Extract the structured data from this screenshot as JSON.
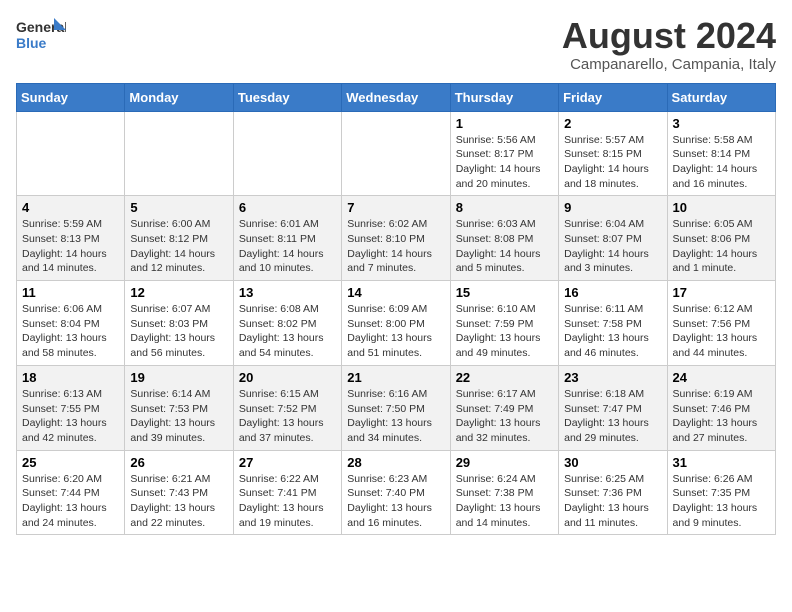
{
  "logo": {
    "line1": "General",
    "line2": "Blue"
  },
  "title": "August 2024",
  "subtitle": "Campanarello, Campania, Italy",
  "headers": [
    "Sunday",
    "Monday",
    "Tuesday",
    "Wednesday",
    "Thursday",
    "Friday",
    "Saturday"
  ],
  "weeks": [
    [
      {
        "num": "",
        "info": ""
      },
      {
        "num": "",
        "info": ""
      },
      {
        "num": "",
        "info": ""
      },
      {
        "num": "",
        "info": ""
      },
      {
        "num": "1",
        "info": "Sunrise: 5:56 AM\nSunset: 8:17 PM\nDaylight: 14 hours\nand 20 minutes."
      },
      {
        "num": "2",
        "info": "Sunrise: 5:57 AM\nSunset: 8:15 PM\nDaylight: 14 hours\nand 18 minutes."
      },
      {
        "num": "3",
        "info": "Sunrise: 5:58 AM\nSunset: 8:14 PM\nDaylight: 14 hours\nand 16 minutes."
      }
    ],
    [
      {
        "num": "4",
        "info": "Sunrise: 5:59 AM\nSunset: 8:13 PM\nDaylight: 14 hours\nand 14 minutes."
      },
      {
        "num": "5",
        "info": "Sunrise: 6:00 AM\nSunset: 8:12 PM\nDaylight: 14 hours\nand 12 minutes."
      },
      {
        "num": "6",
        "info": "Sunrise: 6:01 AM\nSunset: 8:11 PM\nDaylight: 14 hours\nand 10 minutes."
      },
      {
        "num": "7",
        "info": "Sunrise: 6:02 AM\nSunset: 8:10 PM\nDaylight: 14 hours\nand 7 minutes."
      },
      {
        "num": "8",
        "info": "Sunrise: 6:03 AM\nSunset: 8:08 PM\nDaylight: 14 hours\nand 5 minutes."
      },
      {
        "num": "9",
        "info": "Sunrise: 6:04 AM\nSunset: 8:07 PM\nDaylight: 14 hours\nand 3 minutes."
      },
      {
        "num": "10",
        "info": "Sunrise: 6:05 AM\nSunset: 8:06 PM\nDaylight: 14 hours\nand 1 minute."
      }
    ],
    [
      {
        "num": "11",
        "info": "Sunrise: 6:06 AM\nSunset: 8:04 PM\nDaylight: 13 hours\nand 58 minutes."
      },
      {
        "num": "12",
        "info": "Sunrise: 6:07 AM\nSunset: 8:03 PM\nDaylight: 13 hours\nand 56 minutes."
      },
      {
        "num": "13",
        "info": "Sunrise: 6:08 AM\nSunset: 8:02 PM\nDaylight: 13 hours\nand 54 minutes."
      },
      {
        "num": "14",
        "info": "Sunrise: 6:09 AM\nSunset: 8:00 PM\nDaylight: 13 hours\nand 51 minutes."
      },
      {
        "num": "15",
        "info": "Sunrise: 6:10 AM\nSunset: 7:59 PM\nDaylight: 13 hours\nand 49 minutes."
      },
      {
        "num": "16",
        "info": "Sunrise: 6:11 AM\nSunset: 7:58 PM\nDaylight: 13 hours\nand 46 minutes."
      },
      {
        "num": "17",
        "info": "Sunrise: 6:12 AM\nSunset: 7:56 PM\nDaylight: 13 hours\nand 44 minutes."
      }
    ],
    [
      {
        "num": "18",
        "info": "Sunrise: 6:13 AM\nSunset: 7:55 PM\nDaylight: 13 hours\nand 42 minutes."
      },
      {
        "num": "19",
        "info": "Sunrise: 6:14 AM\nSunset: 7:53 PM\nDaylight: 13 hours\nand 39 minutes."
      },
      {
        "num": "20",
        "info": "Sunrise: 6:15 AM\nSunset: 7:52 PM\nDaylight: 13 hours\nand 37 minutes."
      },
      {
        "num": "21",
        "info": "Sunrise: 6:16 AM\nSunset: 7:50 PM\nDaylight: 13 hours\nand 34 minutes."
      },
      {
        "num": "22",
        "info": "Sunrise: 6:17 AM\nSunset: 7:49 PM\nDaylight: 13 hours\nand 32 minutes."
      },
      {
        "num": "23",
        "info": "Sunrise: 6:18 AM\nSunset: 7:47 PM\nDaylight: 13 hours\nand 29 minutes."
      },
      {
        "num": "24",
        "info": "Sunrise: 6:19 AM\nSunset: 7:46 PM\nDaylight: 13 hours\nand 27 minutes."
      }
    ],
    [
      {
        "num": "25",
        "info": "Sunrise: 6:20 AM\nSunset: 7:44 PM\nDaylight: 13 hours\nand 24 minutes."
      },
      {
        "num": "26",
        "info": "Sunrise: 6:21 AM\nSunset: 7:43 PM\nDaylight: 13 hours\nand 22 minutes."
      },
      {
        "num": "27",
        "info": "Sunrise: 6:22 AM\nSunset: 7:41 PM\nDaylight: 13 hours\nand 19 minutes."
      },
      {
        "num": "28",
        "info": "Sunrise: 6:23 AM\nSunset: 7:40 PM\nDaylight: 13 hours\nand 16 minutes."
      },
      {
        "num": "29",
        "info": "Sunrise: 6:24 AM\nSunset: 7:38 PM\nDaylight: 13 hours\nand 14 minutes."
      },
      {
        "num": "30",
        "info": "Sunrise: 6:25 AM\nSunset: 7:36 PM\nDaylight: 13 hours\nand 11 minutes."
      },
      {
        "num": "31",
        "info": "Sunrise: 6:26 AM\nSunset: 7:35 PM\nDaylight: 13 hours\nand 9 minutes."
      }
    ]
  ]
}
